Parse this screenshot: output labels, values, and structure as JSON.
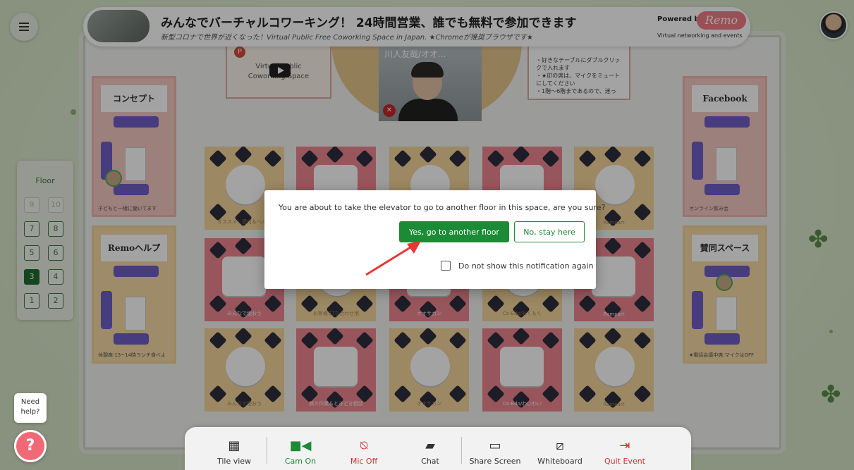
{
  "header": {
    "title": "みんなでバーチャルコワーキング！ 24時間営業、誰でも無料で参加できます",
    "subtitle": "新型コロナで世界が近くなった！Virtual Public Free Coworking Space in Japan.   ★Chromeが推奨ブラウザです★",
    "powered_by": "Powered by",
    "brand": "Remo",
    "tagline": "Virtual networking and events"
  },
  "stage": {
    "video_title": "川人友哉/オオ...",
    "youtube_title_line1": "Virtual Public",
    "youtube_title_line2": "Coworking Space",
    "notes": [
      "・好きなテーブルにダブルクリックで入れます",
      "・★印の席は、マイクをミュートにしてください",
      "・1階〜6階まであるので、迷っ"
    ]
  },
  "side_rooms": {
    "left_top": {
      "label": "コンセプト",
      "footer": "子どもと一緒に働いてます"
    },
    "left_bottom": {
      "label": "Remoヘルプ",
      "footer": "休憩席:13~14時ランチ食べよ"
    },
    "right_top": {
      "label": "Facebook",
      "footer": "オンライン飲み会"
    },
    "right_bottom": {
      "label": "賛同スペース",
      "footer": "★電話会議中席:マイクはOFF"
    }
  },
  "rooms": [
    {
      "color": "yellow",
      "name": "オススメ：受付＆ヘルプ"
    },
    {
      "color": "pink",
      "name": ""
    },
    {
      "color": "yellow",
      "name": ""
    },
    {
      "color": "pink",
      "name": ""
    },
    {
      "color": "yellow",
      "name": "Rampart"
    },
    {
      "color": "pink",
      "name": "みんなで使おう"
    },
    {
      "color": "yellow",
      "name": "お客様:打ち合わせ用"
    },
    {
      "color": "pink",
      "name": "オオサカン"
    },
    {
      "color": "yellow",
      "name": "Co-Edo/もくもく"
    },
    {
      "color": "pink",
      "name": "Rampart"
    },
    {
      "color": "yellow",
      "name": "みんなで使おう"
    },
    {
      "color": "pink",
      "name": "黙々作業＆ときどき雑談"
    },
    {
      "color": "yellow",
      "name": "オオサカン"
    },
    {
      "color": "pink",
      "name": "Co-Edo/わいわい"
    },
    {
      "color": "yellow",
      "name": "Rampart"
    }
  ],
  "floor_panel": {
    "label": "Floor",
    "buttons": [
      {
        "n": "9",
        "state": "disabled"
      },
      {
        "n": "10",
        "state": "disabled"
      },
      {
        "n": "7",
        "state": "normal"
      },
      {
        "n": "8",
        "state": "normal"
      },
      {
        "n": "5",
        "state": "normal"
      },
      {
        "n": "6",
        "state": "normal"
      },
      {
        "n": "3",
        "state": "active"
      },
      {
        "n": "4",
        "state": "normal"
      },
      {
        "n": "1",
        "state": "normal"
      },
      {
        "n": "2",
        "state": "normal"
      }
    ]
  },
  "dialog": {
    "message": "You are about to take the elevator to go to another floor in this space, are you sure?",
    "yes_label": "Yes, go to another floor",
    "no_label": "No, stay here",
    "checkbox_label": "Do not show this notification again",
    "checkbox_checked": false
  },
  "toolbar": {
    "tile_view": "Tile view",
    "cam_on": "Cam On",
    "mic_off": "Mic Off",
    "chat": "Chat",
    "share_screen": "Share Screen",
    "whiteboard": "Whiteboard",
    "quit_event": "Quit Event"
  },
  "help": {
    "line1": "Need",
    "line2": "help?",
    "icon": "?"
  },
  "colors": {
    "accent_green": "#1c8b36",
    "danger_red": "#d32f2f",
    "brand_pink": "#f07c86"
  }
}
